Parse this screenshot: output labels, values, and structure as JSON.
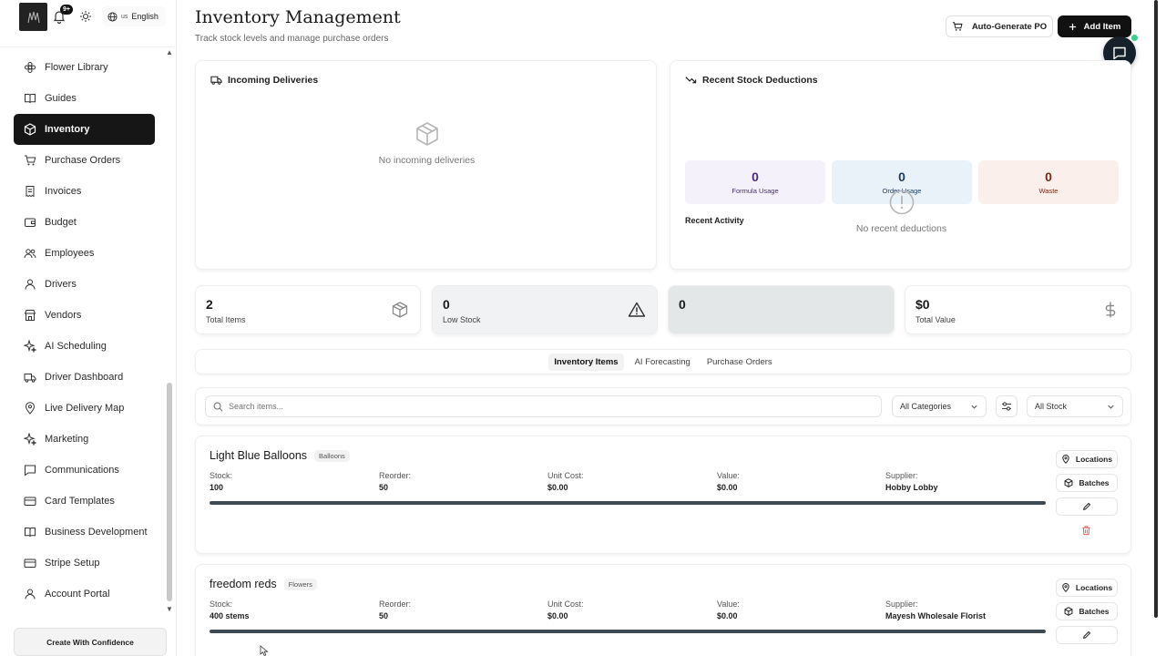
{
  "topbar": {
    "notification_badge": "9+",
    "language_flag": "us",
    "language_label": "English"
  },
  "sidebar": {
    "items": [
      {
        "label": "Flower Library",
        "icon": "flower-icon"
      },
      {
        "label": "Guides",
        "icon": "book-icon"
      },
      {
        "label": "Inventory",
        "icon": "box-icon",
        "active": true
      },
      {
        "label": "Purchase Orders",
        "icon": "cart-icon"
      },
      {
        "label": "Invoices",
        "icon": "receipt-icon"
      },
      {
        "label": "Budget",
        "icon": "wallet-icon"
      },
      {
        "label": "Employees",
        "icon": "users-icon"
      },
      {
        "label": "Drivers",
        "icon": "user-icon"
      },
      {
        "label": "Vendors",
        "icon": "store-icon"
      },
      {
        "label": "AI Scheduling",
        "icon": "sparkle-icon"
      },
      {
        "label": "Driver Dashboard",
        "icon": "truck-icon"
      },
      {
        "label": "Live Delivery Map",
        "icon": "map-pin-icon"
      },
      {
        "label": "Marketing",
        "icon": "sparkle-icon"
      },
      {
        "label": "Communications",
        "icon": "message-icon"
      },
      {
        "label": "Card Templates",
        "icon": "card-icon"
      },
      {
        "label": "Business Development",
        "icon": "book-open-icon"
      },
      {
        "label": "Stripe Setup",
        "icon": "card-icon"
      },
      {
        "label": "Account Portal",
        "icon": "user-icon"
      }
    ],
    "cta_label": "Create With Confidence"
  },
  "header": {
    "title": "Inventory Management",
    "subtitle": "Track stock levels and manage purchase orders",
    "auto_po_label": "Auto-Generate PO",
    "add_item_label": "Add Item"
  },
  "deliveries": {
    "title": "Incoming Deliveries",
    "empty_text": "No incoming deliveries"
  },
  "deductions": {
    "title": "Recent Stock Deductions",
    "stats": [
      {
        "value": "0",
        "label": "Formula Usage",
        "color": "#4a2a7a",
        "bg": "#f5f1fb"
      },
      {
        "value": "0",
        "label": "Order Usage",
        "color": "#1d3a5f",
        "bg": "#eaf2f9"
      },
      {
        "value": "0",
        "label": "Waste",
        "color": "#7a2a1a",
        "bg": "#fbefeb"
      }
    ],
    "recent_activity_label": "Recent Activity",
    "empty_text": "No recent deductions"
  },
  "kpis": [
    {
      "value": "2",
      "label": "Total Items",
      "icon": "box-icon"
    },
    {
      "value": "0",
      "label": "Low Stock",
      "icon": "warning-icon"
    },
    {
      "value": "0",
      "label": "",
      "icon": ""
    },
    {
      "value": "$0",
      "label": "Total Value",
      "icon": "dollar-icon"
    }
  ],
  "tabs": [
    "Inventory Items",
    "AI Forecasting",
    "Purchase Orders"
  ],
  "filters": {
    "search_placeholder": "Search items...",
    "category_value": "All Categories",
    "stock_value": "All Stock"
  },
  "field_labels": {
    "stock": "Stock:",
    "reorder": "Reorder:",
    "unit_cost": "Unit Cost:",
    "value": "Value:",
    "supplier": "Supplier:"
  },
  "action_labels": {
    "locations": "Locations",
    "batches": "Batches"
  },
  "items": [
    {
      "name": "Light Blue Balloons",
      "category": "Balloons",
      "stock": "100",
      "reorder": "50",
      "unit_cost": "$0.00",
      "value": "$0.00",
      "supplier": "Hobby Lobby",
      "stock_level_fraction": 1.0
    },
    {
      "name": "freedom reds",
      "category": "Flowers",
      "stock": "400 stems",
      "reorder": "50",
      "unit_cost": "$0.00",
      "value": "$0.00",
      "supplier": "Mayesh Wholesale Florist",
      "stock_level_fraction": 1.0
    }
  ]
}
